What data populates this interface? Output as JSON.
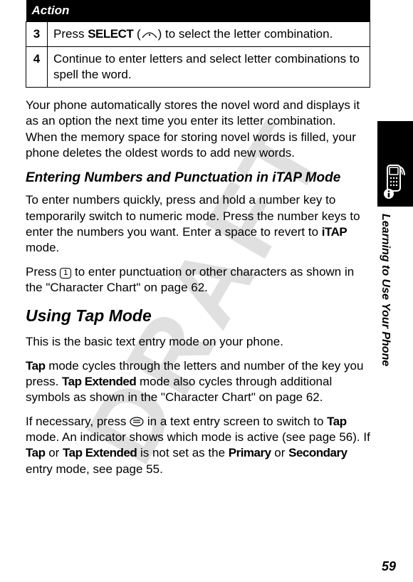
{
  "watermark": "DRAFT",
  "table": {
    "header": "Action",
    "rows": [
      {
        "step": "3",
        "before": "Press ",
        "bold": "SELECT",
        "after": " (",
        "icon_name": "soft-key-icon",
        "after2": ") to select the letter combination."
      },
      {
        "step": "4",
        "text": "Continue to enter letters and select letter combinations to spell the word."
      }
    ]
  },
  "para1": "Your phone automatically stores the novel word and displays it as an option the next time you enter its letter combination. When the memory space for storing novel words is filled, your phone deletes the oldest words to add new words.",
  "subheading1": "Entering Numbers and Punctuation in iTAP Mode",
  "para2_before": "To enter numbers quickly, press and hold a number key to temporarily switch to numeric mode. Press the number keys to enter the numbers you want. Enter a space to revert to ",
  "para2_bold": "iTAP",
  "para2_after": " mode.",
  "para3_before": "Press ",
  "para3_key": "1",
  "para3_after": " to enter punctuation or other characters as shown in the \"Character Chart\" on page 62.",
  "section_heading": "Using Tap Mode",
  "para4": "This is the basic text entry mode on your phone.",
  "para5": {
    "b1": "Tap",
    "t1": " mode cycles through the letters and number of the key you press. ",
    "b2": "Tap Extended",
    "t2": " mode also cycles through additional symbols as shown in the \"Character Chart\" on page 62."
  },
  "para6": {
    "t1": "If necessary, press ",
    "icon_name": "menu-key-icon",
    "t2": " in a text entry screen to switch to ",
    "b1": "Tap",
    "t3": " mode. An indicator shows which mode is active (see page 56). If ",
    "b2": "Tap",
    "t4": " or ",
    "b3": "Tap Extended",
    "t5": " is not set as the ",
    "b4": "Primary",
    "t6": " or ",
    "b5": "Secondary",
    "t7": " entry mode, see page 55."
  },
  "side_label": "Learning to Use Your Phone",
  "page_number": "59"
}
